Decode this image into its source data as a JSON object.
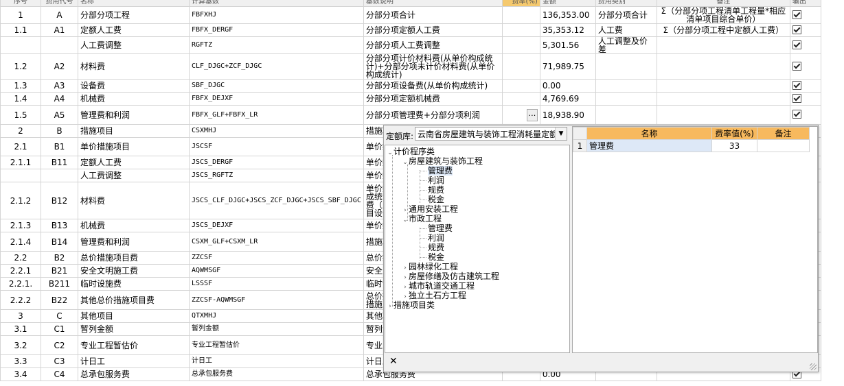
{
  "header": {
    "cols": [
      "序号",
      "费用代号",
      "名称",
      "计算基数",
      "基数说明",
      "费率(%)",
      "金额",
      "费用类别",
      "备注",
      "输出"
    ]
  },
  "rows": [
    {
      "seq": "1",
      "code": "A",
      "name": "分部分项工程",
      "base": "FBFXHJ",
      "desc": "分部分项合计",
      "rate": "",
      "amount": "136,353.00",
      "cat": "分部分项合计",
      "note": "Σ（分部分项工程清单工程量*相应清单项目综合单价）",
      "out": true
    },
    {
      "seq": "1.1",
      "code": "A1",
      "name": "定额人工费",
      "base": "FBFX_DERGF",
      "desc": "分部分项定额人工费",
      "rate": "",
      "amount": "35,353.12",
      "cat": "人工费",
      "note": "Σ（分部分项工程中定额人工费）",
      "out": true
    },
    {
      "seq": "",
      "code": "",
      "name": "人工费调整",
      "base": "RGFTZ",
      "desc": "分部分项人工费调整",
      "rate": "",
      "amount": "5,301.56",
      "cat": "人工调整及价差",
      "note": "",
      "out": true
    },
    {
      "seq": "1.2",
      "code": "A2",
      "name": "材料费",
      "base": "CLF_DJGC+ZCF_DJGC",
      "desc": "分部分项计价材料费(从单价构成统计)+分部分项未计价材料费(从单价构成统计)",
      "rate": "",
      "amount": "71,989.75",
      "cat": "",
      "note": "",
      "out": true
    },
    {
      "seq": "1.3",
      "code": "A3",
      "name": "设备费",
      "base": "SBF_DJGC",
      "desc": "分部分项设备费(从单价构成统计)",
      "rate": "",
      "amount": "0.00",
      "cat": "",
      "note": "",
      "out": true
    },
    {
      "seq": "1.4",
      "code": "A4",
      "name": "机械费",
      "base": "FBFX_DEJXF",
      "desc": "分部分项定额机械费",
      "rate": "",
      "amount": "4,769.69",
      "cat": "",
      "note": "",
      "out": true
    },
    {
      "seq": "1.5",
      "code": "A5",
      "name": "管理费和利润",
      "base": "FBFX_GLF+FBFX_LR",
      "desc": "分部分项管理费+分部分项利润",
      "rate": "…",
      "amount": "18,938.90",
      "cat": "",
      "note": "",
      "out": true
    },
    {
      "seq": "2",
      "code": "B",
      "name": "措施项目",
      "base": "CSXMHJ",
      "desc": "措施项目合计",
      "rate": "",
      "amount": "",
      "cat": "",
      "note": "",
      "out": false
    },
    {
      "seq": "2.1",
      "code": "B1",
      "name": "单价措施项目",
      "base": "JSCSF",
      "desc": "单价措施项目合计",
      "rate": "",
      "amount": "",
      "cat": "",
      "note": "",
      "out": false
    },
    {
      "seq": "2.1.1",
      "code": "B11",
      "name": "定额人工费",
      "base": "JSCS_DERGF",
      "desc": "单价措施定额人工费",
      "rate": "",
      "amount": "",
      "cat": "",
      "note": "",
      "out": false
    },
    {
      "seq": "",
      "code": "",
      "name": "人工费调整",
      "base": "JSCS_RGFTZ",
      "desc": "单价措施项目人工费调整",
      "rate": "",
      "amount": "",
      "cat": "",
      "note": "",
      "out": false
    },
    {
      "seq": "2.1.2",
      "code": "B12",
      "name": "材料费",
      "base": "JSCS_CLF_DJGC+JSCS_ZCF_DJGC+JSCS_SBF_DJGC",
      "desc": "单价措施项目计价材料费（从单价构成统计）+单价措施项目未计价材料费（从单价构成统计）+单价措施项目设备费(从单价构成统计)",
      "rate": "",
      "amount": "",
      "cat": "",
      "note": "",
      "out": false
    },
    {
      "seq": "2.1.3",
      "code": "B13",
      "name": "机械费",
      "base": "JSCS_DEJXF",
      "desc": "单价措施定额机械费",
      "rate": "",
      "amount": "",
      "cat": "",
      "note": "",
      "out": false
    },
    {
      "seq": "2.1.4",
      "code": "B14",
      "name": "管理费和利润",
      "base": "CSXM_GLF+CSXM_LR",
      "desc": "措施项目管理费+措施项目利润",
      "rate": "",
      "amount": "",
      "cat": "",
      "note": "",
      "out": false
    },
    {
      "seq": "2.2",
      "code": "B2",
      "name": "总价措施项目费",
      "base": "ZZCSF",
      "desc": "总价措施项目合计",
      "rate": "",
      "amount": "",
      "cat": "",
      "note": "",
      "out": false
    },
    {
      "seq": "2.2.1",
      "code": "B21",
      "name": "安全文明施工费",
      "base": "AQWMSGF",
      "desc": "安全及文明施工措施费",
      "rate": "",
      "amount": "",
      "cat": "",
      "note": "",
      "out": false
    },
    {
      "seq": "2.2.1.",
      "code": "B211",
      "name": "临时设施费",
      "base": "LSSSF",
      "desc": "临时设施费",
      "rate": "",
      "amount": "",
      "cat": "",
      "note": "",
      "out": false
    },
    {
      "seq": "2.2.2",
      "code": "B22",
      "name": "其他总价措施项目费",
      "base": "ZZCSF-AQWMSGF",
      "desc": "总价措施项目合计-安全及文明施工措施费",
      "rate": "",
      "amount": "",
      "cat": "",
      "note": "",
      "out": false
    },
    {
      "seq": "3",
      "code": "C",
      "name": "其他项目",
      "base": "QTXMHJ",
      "desc": "其他项目合计",
      "rate": "",
      "amount": "",
      "cat": "",
      "note": "",
      "out": false
    },
    {
      "seq": "3.1",
      "code": "C1",
      "name": "暂列金额",
      "base": "暂列金额",
      "desc": "暂列金额",
      "rate": "",
      "amount": "",
      "cat": "",
      "note": "",
      "out": false
    },
    {
      "seq": "3.2",
      "code": "C2",
      "name": "专业工程暂估价",
      "base": "专业工程暂估价",
      "desc": "专业工程暂估价",
      "rate": "",
      "amount": "",
      "cat": "",
      "note": "",
      "out": false
    },
    {
      "seq": "3.3",
      "code": "C3",
      "name": "计日工",
      "base": "计日工",
      "desc": "计日工",
      "rate": "",
      "amount": "",
      "cat": "",
      "note": "",
      "out": false
    },
    {
      "seq": "3.4",
      "code": "C4",
      "name": "总承包服务费",
      "base": "总承包服务费",
      "desc": "总承包服务费",
      "rate": "",
      "amount": "0.00",
      "cat": "",
      "note": "",
      "out": true
    }
  ],
  "popup": {
    "lib_label": "定额库:",
    "lib_value": "云南省房屋建筑与装饰工程消耗量定额",
    "tree": {
      "root": "计价程序类",
      "house": "房屋建筑与装饰工程",
      "house_items": [
        "管理费",
        "利润",
        "规费",
        "税金"
      ],
      "install": "通用安装工程",
      "municipal": "市政工程",
      "municipal_items": [
        "管理费",
        "利润",
        "规费",
        "税金"
      ],
      "garden": "园林绿化工程",
      "restore": "房屋修缮及仿古建筑工程",
      "rail": "城市轨道交通工程",
      "earth": "独立土石方工程",
      "measures": "措施项目类"
    },
    "rate_table": {
      "headers": [
        "名称",
        "费率值(%)",
        "备注"
      ],
      "rows": [
        {
          "idx": "1",
          "name": "管理费",
          "value": "33",
          "note": ""
        }
      ]
    },
    "close": "✕"
  }
}
